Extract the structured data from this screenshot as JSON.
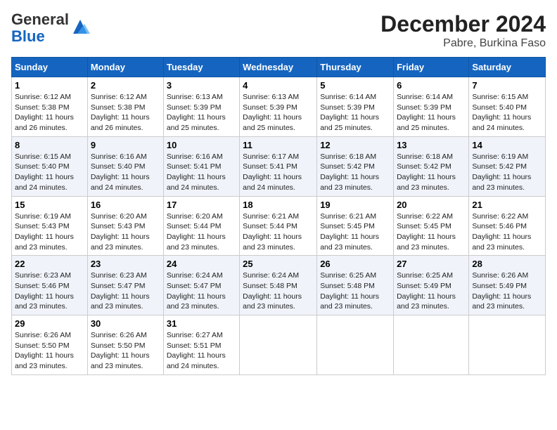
{
  "logo": {
    "general": "General",
    "blue": "Blue"
  },
  "title": "December 2024",
  "subtitle": "Pabre, Burkina Faso",
  "days_of_week": [
    "Sunday",
    "Monday",
    "Tuesday",
    "Wednesday",
    "Thursday",
    "Friday",
    "Saturday"
  ],
  "weeks": [
    [
      {
        "day": 1,
        "sunrise": "6:12 AM",
        "sunset": "5:38 PM",
        "daylight": "11 hours and 26 minutes."
      },
      {
        "day": 2,
        "sunrise": "6:12 AM",
        "sunset": "5:38 PM",
        "daylight": "11 hours and 26 minutes."
      },
      {
        "day": 3,
        "sunrise": "6:13 AM",
        "sunset": "5:39 PM",
        "daylight": "11 hours and 25 minutes."
      },
      {
        "day": 4,
        "sunrise": "6:13 AM",
        "sunset": "5:39 PM",
        "daylight": "11 hours and 25 minutes."
      },
      {
        "day": 5,
        "sunrise": "6:14 AM",
        "sunset": "5:39 PM",
        "daylight": "11 hours and 25 minutes."
      },
      {
        "day": 6,
        "sunrise": "6:14 AM",
        "sunset": "5:39 PM",
        "daylight": "11 hours and 25 minutes."
      },
      {
        "day": 7,
        "sunrise": "6:15 AM",
        "sunset": "5:40 PM",
        "daylight": "11 hours and 24 minutes."
      }
    ],
    [
      {
        "day": 8,
        "sunrise": "6:15 AM",
        "sunset": "5:40 PM",
        "daylight": "11 hours and 24 minutes."
      },
      {
        "day": 9,
        "sunrise": "6:16 AM",
        "sunset": "5:40 PM",
        "daylight": "11 hours and 24 minutes."
      },
      {
        "day": 10,
        "sunrise": "6:16 AM",
        "sunset": "5:41 PM",
        "daylight": "11 hours and 24 minutes."
      },
      {
        "day": 11,
        "sunrise": "6:17 AM",
        "sunset": "5:41 PM",
        "daylight": "11 hours and 24 minutes."
      },
      {
        "day": 12,
        "sunrise": "6:18 AM",
        "sunset": "5:42 PM",
        "daylight": "11 hours and 23 minutes."
      },
      {
        "day": 13,
        "sunrise": "6:18 AM",
        "sunset": "5:42 PM",
        "daylight": "11 hours and 23 minutes."
      },
      {
        "day": 14,
        "sunrise": "6:19 AM",
        "sunset": "5:42 PM",
        "daylight": "11 hours and 23 minutes."
      }
    ],
    [
      {
        "day": 15,
        "sunrise": "6:19 AM",
        "sunset": "5:43 PM",
        "daylight": "11 hours and 23 minutes."
      },
      {
        "day": 16,
        "sunrise": "6:20 AM",
        "sunset": "5:43 PM",
        "daylight": "11 hours and 23 minutes."
      },
      {
        "day": 17,
        "sunrise": "6:20 AM",
        "sunset": "5:44 PM",
        "daylight": "11 hours and 23 minutes."
      },
      {
        "day": 18,
        "sunrise": "6:21 AM",
        "sunset": "5:44 PM",
        "daylight": "11 hours and 23 minutes."
      },
      {
        "day": 19,
        "sunrise": "6:21 AM",
        "sunset": "5:45 PM",
        "daylight": "11 hours and 23 minutes."
      },
      {
        "day": 20,
        "sunrise": "6:22 AM",
        "sunset": "5:45 PM",
        "daylight": "11 hours and 23 minutes."
      },
      {
        "day": 21,
        "sunrise": "6:22 AM",
        "sunset": "5:46 PM",
        "daylight": "11 hours and 23 minutes."
      }
    ],
    [
      {
        "day": 22,
        "sunrise": "6:23 AM",
        "sunset": "5:46 PM",
        "daylight": "11 hours and 23 minutes."
      },
      {
        "day": 23,
        "sunrise": "6:23 AM",
        "sunset": "5:47 PM",
        "daylight": "11 hours and 23 minutes."
      },
      {
        "day": 24,
        "sunrise": "6:24 AM",
        "sunset": "5:47 PM",
        "daylight": "11 hours and 23 minutes."
      },
      {
        "day": 25,
        "sunrise": "6:24 AM",
        "sunset": "5:48 PM",
        "daylight": "11 hours and 23 minutes."
      },
      {
        "day": 26,
        "sunrise": "6:25 AM",
        "sunset": "5:48 PM",
        "daylight": "11 hours and 23 minutes."
      },
      {
        "day": 27,
        "sunrise": "6:25 AM",
        "sunset": "5:49 PM",
        "daylight": "11 hours and 23 minutes."
      },
      {
        "day": 28,
        "sunrise": "6:26 AM",
        "sunset": "5:49 PM",
        "daylight": "11 hours and 23 minutes."
      }
    ],
    [
      {
        "day": 29,
        "sunrise": "6:26 AM",
        "sunset": "5:50 PM",
        "daylight": "11 hours and 23 minutes."
      },
      {
        "day": 30,
        "sunrise": "6:26 AM",
        "sunset": "5:50 PM",
        "daylight": "11 hours and 23 minutes."
      },
      {
        "day": 31,
        "sunrise": "6:27 AM",
        "sunset": "5:51 PM",
        "daylight": "11 hours and 24 minutes."
      },
      null,
      null,
      null,
      null
    ]
  ]
}
